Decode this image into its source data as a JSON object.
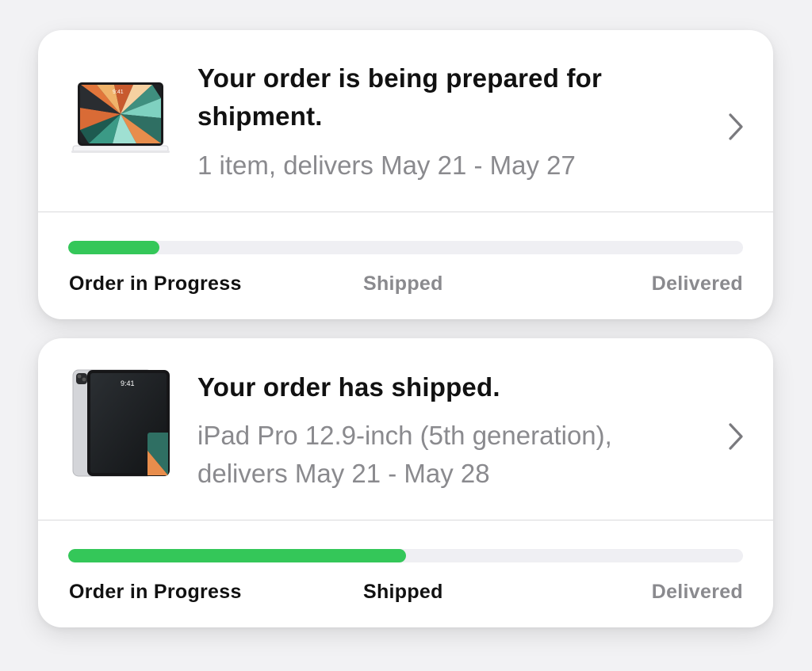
{
  "colors": {
    "progress_fill": "#34c759",
    "track": "#efeff3",
    "active_label": "#111111",
    "inactive_label": "#8a8a8e"
  },
  "orders": [
    {
      "title": "Your order is being prepared for shipment.",
      "subtitle": "1 item, delivers May 21 - May 27",
      "image_icon": "ipad-with-magic-keyboard-image",
      "progress": 0.135,
      "steps": [
        {
          "label": "Order in Progress",
          "state": "active"
        },
        {
          "label": "Shipped",
          "state": "inactive"
        },
        {
          "label": "Delivered",
          "state": "inactive"
        }
      ]
    },
    {
      "title": "Your order has shipped.",
      "subtitle": "iPad Pro 12.9-inch (5th generation), delivers May 21 - May 28",
      "image_icon": "ipad-pro-image",
      "progress": 0.5,
      "steps": [
        {
          "label": "Order in Progress",
          "state": "active"
        },
        {
          "label": "Shipped",
          "state": "active"
        },
        {
          "label": "Delivered",
          "state": "inactive"
        }
      ]
    }
  ]
}
